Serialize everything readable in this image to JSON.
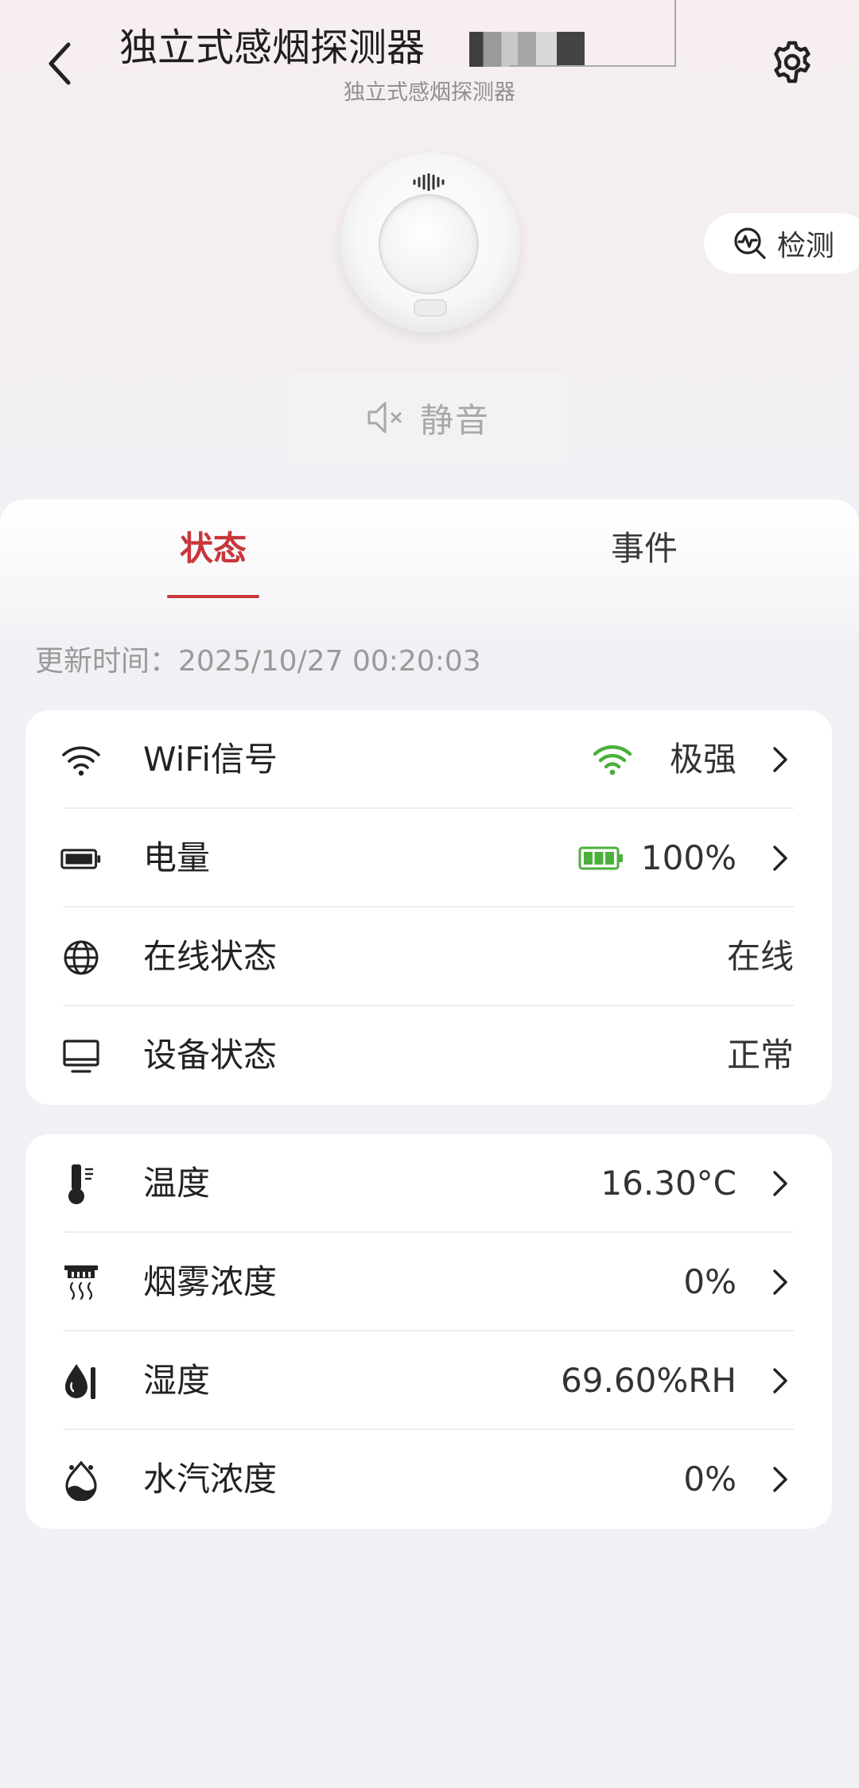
{
  "header": {
    "title": "独立式感烟探测器",
    "subtitle": "独立式感烟探测器"
  },
  "actions": {
    "detect_label": "检测",
    "mute_label": "静音"
  },
  "tabs": [
    {
      "label": "状态",
      "active": true
    },
    {
      "label": "事件",
      "active": false
    }
  ],
  "update": {
    "label": "更新时间：",
    "time": "2025/10/27 00:20:03"
  },
  "status_card": [
    {
      "icon": "wifi-icon",
      "label": "WiFi信号",
      "value": "极强",
      "status_icon": "wifi-strong-icon",
      "arrow": true
    },
    {
      "icon": "battery-icon",
      "label": "电量",
      "value": "100%",
      "status_icon": "battery-full-icon",
      "arrow": true
    },
    {
      "icon": "globe-icon",
      "label": "在线状态",
      "value": "在线",
      "arrow": false
    },
    {
      "icon": "monitor-icon",
      "label": "设备状态",
      "value": "正常",
      "arrow": false
    }
  ],
  "sensor_card": [
    {
      "icon": "thermometer-icon",
      "label": "温度",
      "value": "16.30°C",
      "arrow": true
    },
    {
      "icon": "smoke-icon",
      "label": "烟雾浓度",
      "value": "0%",
      "arrow": true
    },
    {
      "icon": "humidity-icon",
      "label": "湿度",
      "value": "69.60%RH",
      "arrow": true
    },
    {
      "icon": "water-vapor-icon",
      "label": "水汽浓度",
      "value": "0%",
      "arrow": true
    }
  ],
  "colors": {
    "accent": "#c8363a",
    "good": "#4caf3c"
  }
}
